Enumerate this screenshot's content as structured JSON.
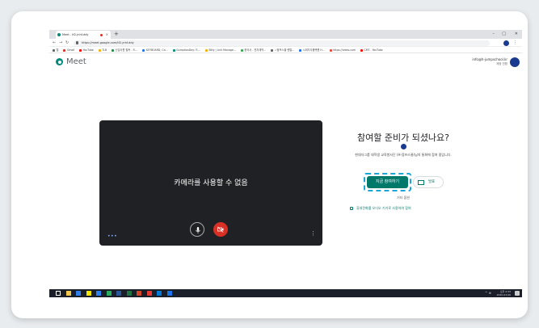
{
  "browser": {
    "tab_title": "Meet - tf2-jnhf-ddy",
    "new_tab": "+",
    "address": "https://meet.google.com/tf2-jnhf-ddy",
    "controls": {
      "minimize": "–",
      "maximize": "□",
      "close": "✕"
    }
  },
  "bookmarks": [
    {
      "label": "앱",
      "color": "#5f6368"
    },
    {
      "label": "Gmail",
      "color": "#d93025"
    },
    {
      "label": "YouTube",
      "color": "#ff0000"
    },
    {
      "label": "TLB",
      "color": "#f9ab00"
    },
    {
      "label": "신입사원 필독 - 드...",
      "color": "#1e8e3e"
    },
    {
      "label": "KEYBOARD, Co...",
      "color": "#1a73e8"
    },
    {
      "label": "GumptionDay: 드...",
      "color": "#00897b"
    },
    {
      "label": "Bitly | Link Manage...",
      "color": "#f9ab00"
    },
    {
      "label": "한국사 - 전자계약...",
      "color": "#34a853"
    },
    {
      "label": "ㅅ점프스쿨 렌탈...",
      "color": "#5f6368"
    },
    {
      "label": "시대지식플랫폼 H...",
      "color": "#1a73e8"
    },
    {
      "label": "https://video.com",
      "color": "#ea4335"
    },
    {
      "label": "CMT - YouTube",
      "color": "#ff0000"
    }
  ],
  "meet": {
    "title": "Meet",
    "account_email": "info@h-jumpschool.kr",
    "account_switch": "계정 전환",
    "preview_message": "카메라를 사용할 수 없음",
    "preview_dots": "•••",
    "ready_title": "참여할 준비가 되셨나요?",
    "others_text": "현대자그룹 대학생 교육봉사단 (H-점프스쿨)님의 통화에 참여 중입니다.",
    "join_label": "지금 참여하기",
    "present_label": "발표",
    "other_options": "기타 옵션",
    "phone_audio": "휴대전화를 오디오 기기로 사용하여 참여"
  },
  "taskbar": {
    "time": "오후 2:33",
    "date": "2020-03-06",
    "tray": "^ ⊕",
    "icons": [
      {
        "name": "start-icon",
        "color": "#ffffff"
      },
      {
        "name": "search-icon",
        "color": "#f2c94c"
      },
      {
        "name": "explorer-icon",
        "color": "#2f80ed"
      },
      {
        "name": "kakao-icon",
        "color": "#f7e600"
      },
      {
        "name": "mail-icon",
        "color": "#2f80ed"
      },
      {
        "name": "edge-icon",
        "color": "#27ae60"
      },
      {
        "name": "word-icon",
        "color": "#2b579a"
      },
      {
        "name": "excel-icon",
        "color": "#217346"
      },
      {
        "name": "ppt-icon",
        "color": "#d24726"
      },
      {
        "name": "chrome-icon",
        "color": "#e53935"
      },
      {
        "name": "store-icon",
        "color": "#0078d7"
      },
      {
        "name": "app-icon",
        "color": "#1a73e8"
      }
    ]
  }
}
